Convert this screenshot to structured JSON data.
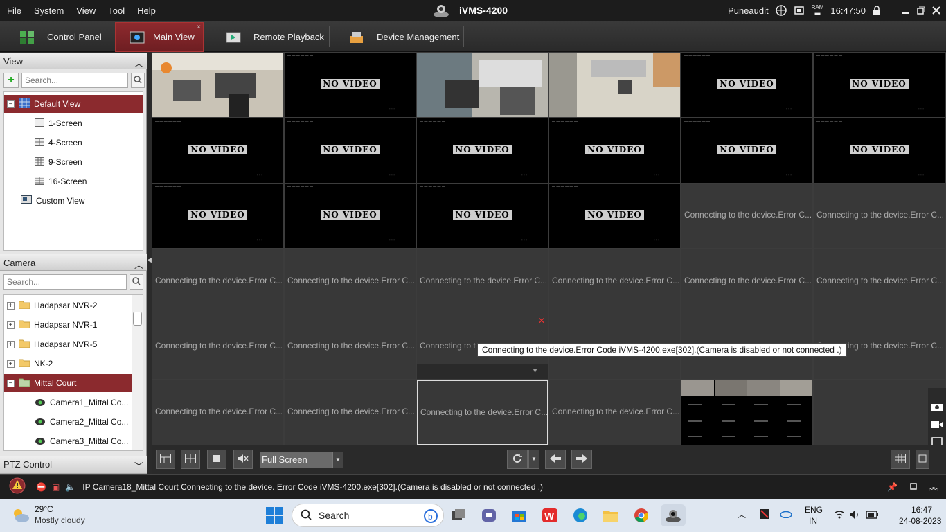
{
  "menu": [
    "File",
    "System",
    "View",
    "Tool",
    "Help"
  ],
  "app_title": "iVMS-4200",
  "user": "Puneaudit",
  "clock": "16:47:50",
  "ram_label": "RAM",
  "tabs": [
    {
      "label": "Control Panel"
    },
    {
      "label": "Main View"
    },
    {
      "label": "Remote Playback"
    },
    {
      "label": "Device Management"
    }
  ],
  "view_panel": {
    "title": "View",
    "search_placeholder": "Search...",
    "items": [
      {
        "label": "Default View"
      },
      {
        "label": "1-Screen"
      },
      {
        "label": "4-Screen"
      },
      {
        "label": "9-Screen"
      },
      {
        "label": "16-Screen"
      },
      {
        "label": "Custom View"
      }
    ]
  },
  "camera_panel": {
    "title": "Camera",
    "search_placeholder": "Search...",
    "items": [
      {
        "label": "Hadapsar NVR-2"
      },
      {
        "label": "Hadapsar NVR-1"
      },
      {
        "label": "Hadapsar NVR-5"
      },
      {
        "label": "NK-2"
      },
      {
        "label": "Mittal Court"
      },
      {
        "label": "Camera1_Mittal Co..."
      },
      {
        "label": "Camera2_Mittal Co..."
      },
      {
        "label": "Camera3_Mittal Co..."
      }
    ]
  },
  "ptz_title": "PTZ Control",
  "no_video": "NO VIDEO",
  "connecting": "Connecting to the device.Error C...",
  "connecting_short": "Connecting to t",
  "tooltip": "Connecting to the device.Error Code iVMS-4200.exe[302].(Camera is disabled or not connected .)",
  "fullscreen": "Full Screen",
  "status_message": "IP Camera18_Mittal Court Connecting to the device. Error Code iVMS-4200.exe[302].(Camera is disabled or not connected .)",
  "taskbar": {
    "temp": "29°C",
    "weather": "Mostly cloudy",
    "search": "Search",
    "lang1": "ENG",
    "lang2": "IN",
    "time": "16:47",
    "date": "24-08-2023"
  },
  "colors": {
    "accent": "#8b2a2e",
    "nv_bg": "#000000"
  }
}
